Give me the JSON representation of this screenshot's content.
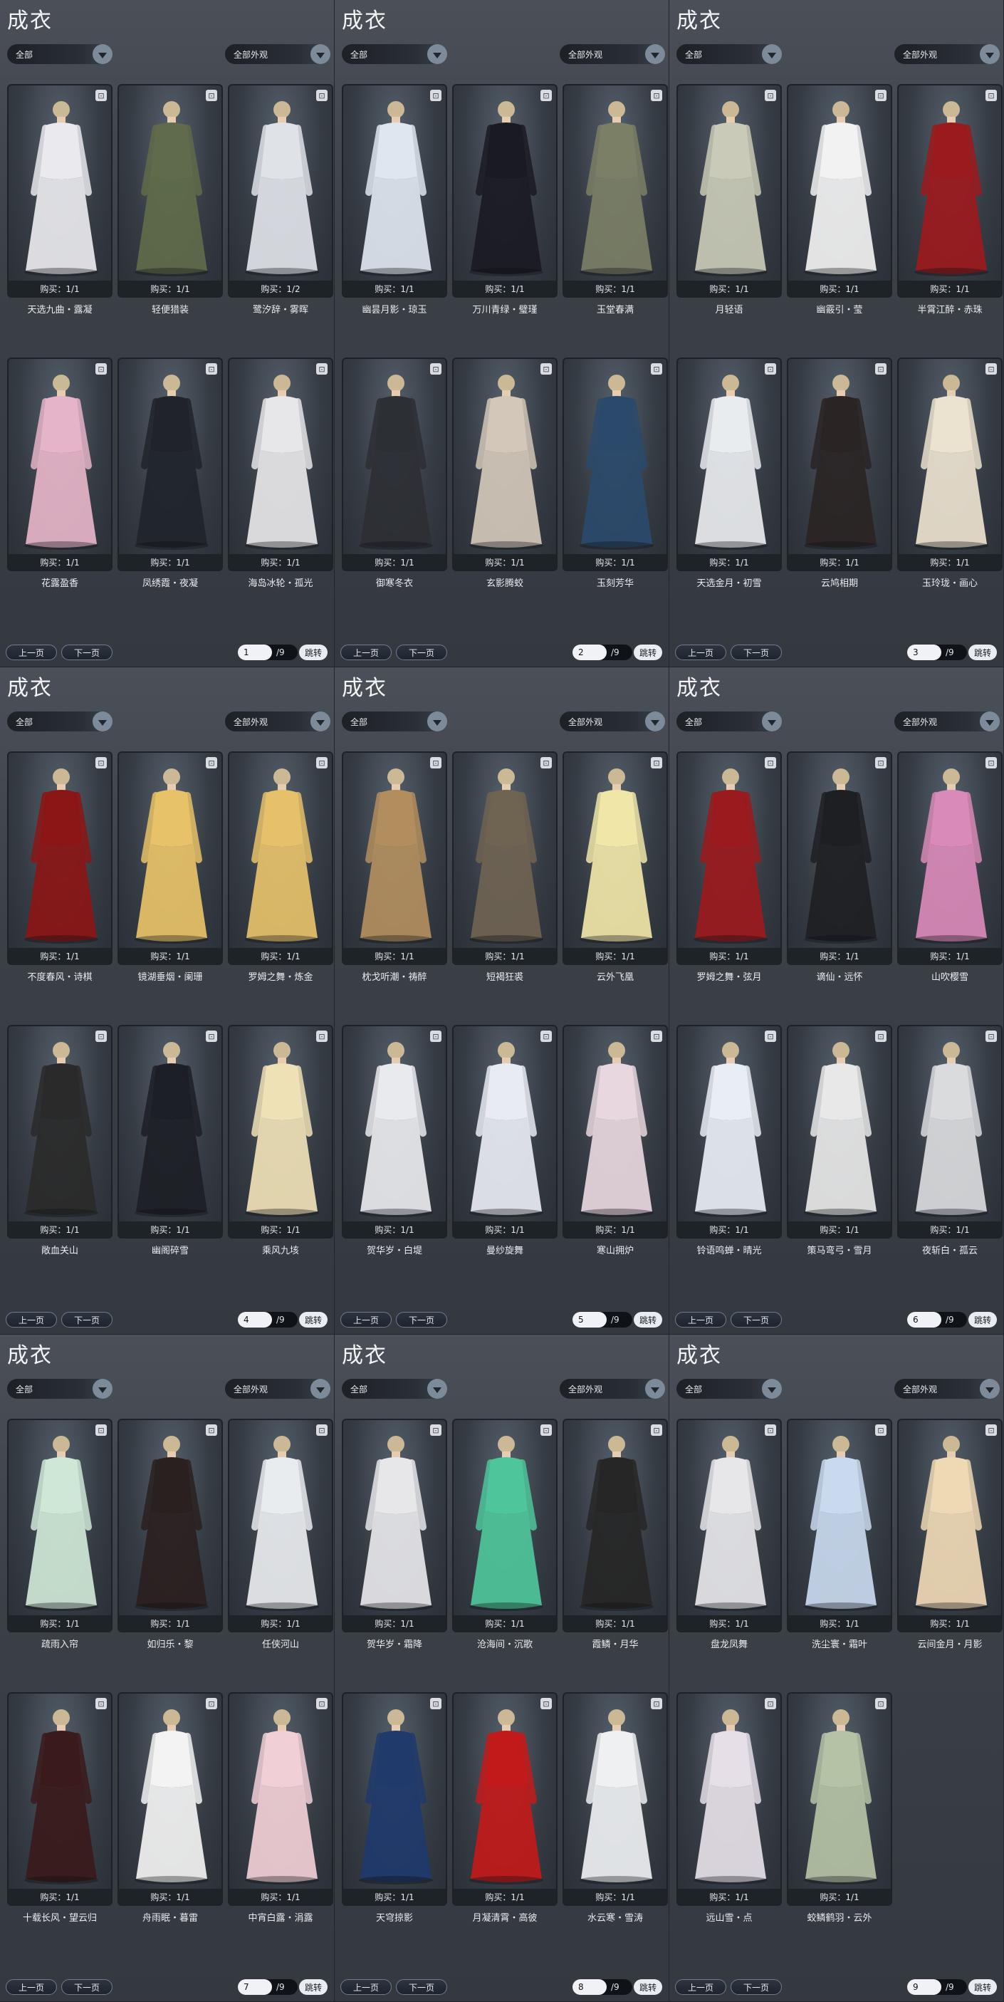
{
  "common": {
    "title": "成衣",
    "filter_all": "全部",
    "filter_appearance": "全部外观",
    "prev": "上一页",
    "next": "下一页",
    "jump": "跳转",
    "total_pages": "/9"
  },
  "pages": [
    {
      "page": "1",
      "items": [
        {
          "name": "天选九曲・露凝",
          "buy": "购买：1/1"
        },
        {
          "name": "轻便猎装",
          "buy": "购买：1/1"
        },
        {
          "name": "鹭汐辞・雾晖",
          "buy": "购买：1/2"
        },
        {
          "name": "花露盈香",
          "buy": "购买：1/1"
        },
        {
          "name": "凤绣霞・夜凝",
          "buy": "购买：1/1"
        },
        {
          "name": "海岛冰轮・孤光",
          "buy": "购买：1/1"
        }
      ]
    },
    {
      "page": "2",
      "items": [
        {
          "name": "幽昙月影・琼玉",
          "buy": "购买：1/1"
        },
        {
          "name": "万川青绿・璧瑾",
          "buy": "购买：1/1"
        },
        {
          "name": "玉堂春满",
          "buy": "购买：1/1"
        },
        {
          "name": "御寒冬衣",
          "buy": "购买：1/1"
        },
        {
          "name": "玄影腾蛟",
          "buy": "购买：1/1"
        },
        {
          "name": "玉刻芳华",
          "buy": "购买：1/1"
        }
      ]
    },
    {
      "page": "3",
      "items": [
        {
          "name": "月轻语",
          "buy": "购买：1/1"
        },
        {
          "name": "幽霰引・莹",
          "buy": "购买：1/1"
        },
        {
          "name": "半霄江醉・赤珠",
          "buy": "购买：1/1"
        },
        {
          "name": "天选金月・初雪",
          "buy": "购买：1/1"
        },
        {
          "name": "云鸠相期",
          "buy": "购买：1/1"
        },
        {
          "name": "玉玲珑・画心",
          "buy": "购买：1/1"
        }
      ]
    },
    {
      "page": "4",
      "items": [
        {
          "name": "不度春风・诗棋",
          "buy": "购买：1/1"
        },
        {
          "name": "镜湖垂烟・阑珊",
          "buy": "购买：1/1"
        },
        {
          "name": "罗姆之舞・炼金",
          "buy": "购买：1/1"
        },
        {
          "name": "敞血关山",
          "buy": "购买：1/1"
        },
        {
          "name": "幽阁碎雪",
          "buy": "购买：1/1"
        },
        {
          "name": "乘风九垓",
          "buy": "购买：1/1"
        }
      ]
    },
    {
      "page": "5",
      "items": [
        {
          "name": "枕戈听潮・祷醉",
          "buy": "购买：1/1"
        },
        {
          "name": "短褐狂裘",
          "buy": "购买：1/1"
        },
        {
          "name": "云外飞凰",
          "buy": "购买：1/1"
        },
        {
          "name": "贺华岁・白堤",
          "buy": "购买：1/1"
        },
        {
          "name": "曼纱旋舞",
          "buy": "购买：1/1"
        },
        {
          "name": "寒山拥炉",
          "buy": "购买：1/1"
        }
      ]
    },
    {
      "page": "6",
      "items": [
        {
          "name": "罗姆之舞・弦月",
          "buy": "购买：1/1"
        },
        {
          "name": "谪仙・远怀",
          "buy": "购买：1/1"
        },
        {
          "name": "山吹樱雪",
          "buy": "购买：1/1"
        },
        {
          "name": "铃语鸣蝉・晴光",
          "buy": "购买：1/1"
        },
        {
          "name": "策马弯弓・雪月",
          "buy": "购买：1/1"
        },
        {
          "name": "夜斩白・孤云",
          "buy": "购买：1/1"
        }
      ]
    },
    {
      "page": "7",
      "items": [
        {
          "name": "疏雨入帘",
          "buy": "购买：1/1"
        },
        {
          "name": "如归乐・黎",
          "buy": "购买：1/1"
        },
        {
          "name": "任侠河山",
          "buy": "购买：1/1"
        },
        {
          "name": "十载长风・望云归",
          "buy": "购买：1/1"
        },
        {
          "name": "舟雨眠・暮雷",
          "buy": "购买：1/1"
        },
        {
          "name": "中宵白露・涓露",
          "buy": "购买：1/1"
        }
      ]
    },
    {
      "page": "8",
      "items": [
        {
          "name": "贺华岁・霜降",
          "buy": "购买：1/1"
        },
        {
          "name": "沧海间・沉歌",
          "buy": "购买：1/1"
        },
        {
          "name": "霞鳞・月华",
          "buy": "购买：1/1"
        },
        {
          "name": "天穹掠影",
          "buy": "购买：1/1"
        },
        {
          "name": "月凝清霄・高彼",
          "buy": "购买：1/1"
        },
        {
          "name": "水云寒・雪涛",
          "buy": "购买：1/1"
        }
      ]
    },
    {
      "page": "9",
      "items": [
        {
          "name": "盘龙凤舞",
          "buy": "购买：1/1"
        },
        {
          "name": "洗尘寰・霜叶",
          "buy": "购买：1/1"
        },
        {
          "name": "云间金月・月影",
          "buy": "购买：1/1"
        },
        {
          "name": "远山雪・点",
          "buy": "购买：1/1"
        },
        {
          "name": "蛟鳞鹤羽・云外",
          "buy": "购买：1/1"
        }
      ]
    }
  ],
  "outfit_colors": [
    [
      "#e9e9ee",
      "#5f6b4a",
      "#dfe3e8",
      "#e6b4c8",
      "#20242a",
      "#e7e6e8"
    ],
    [
      "#dfe6ef",
      "#1a1a22",
      "#7b7f66",
      "#2c2f34",
      "#d2c7b8",
      "#2b4a6b"
    ],
    [
      "#c9cab7",
      "#f2f2f2",
      "#9b1a1d",
      "#e9ecef",
      "#2a2424",
      "#ebe2cf"
    ],
    [
      "#8b1616",
      "#e7c268",
      "#e6c16a",
      "#2a2a2a",
      "#1c1f25",
      "#efe1b6"
    ],
    [
      "#b28e5e",
      "#6f6352",
      "#f0e6a8",
      "#e9eaee",
      "#e8ecf2",
      "#e8d7de"
    ],
    [
      "#9a1a1d",
      "#1e1f23",
      "#d98ab8",
      "#e9eef4",
      "#e8e8e8",
      "#dadbdd"
    ],
    [
      "#cfe8d6",
      "#2a2020",
      "#e9ecef",
      "#3a1a1a",
      "#f3f3f3",
      "#f1cfd6"
    ],
    [
      "#e7e7ea",
      "#4ec59a",
      "#262626",
      "#1f3a6b",
      "#c21a1a",
      "#eef0f2"
    ],
    [
      "#e7e7ea",
      "#c9d9ee",
      "#efd9b5",
      "#e6dfe7",
      "#b5c2a5"
    ]
  ]
}
